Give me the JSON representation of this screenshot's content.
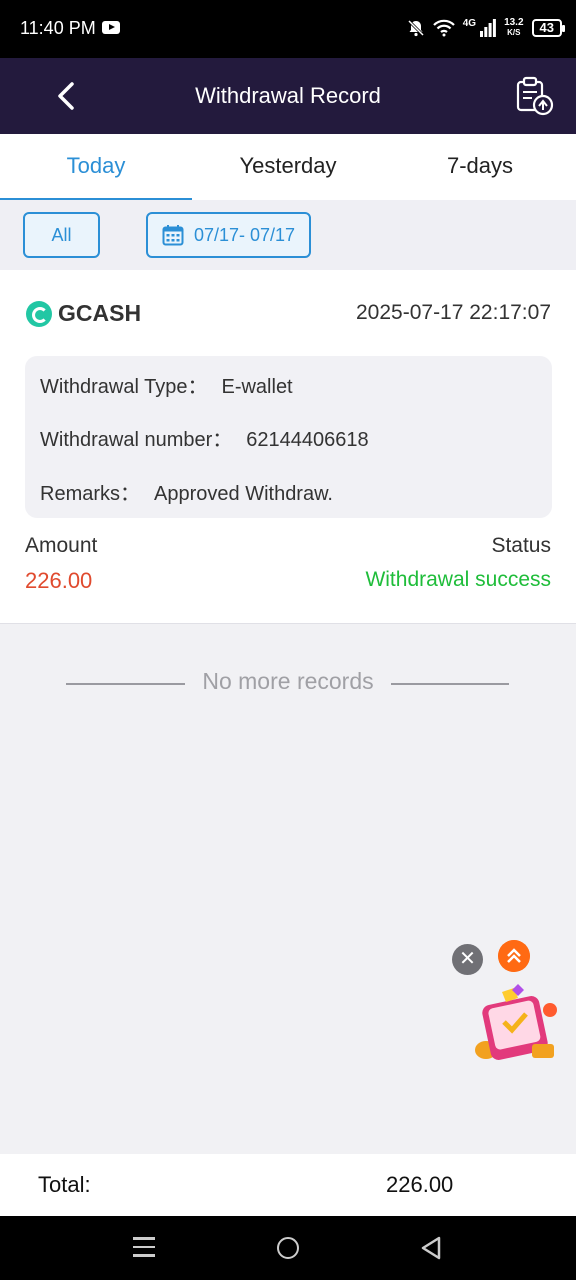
{
  "status_bar": {
    "time": "11:40 PM",
    "network_type": "4G",
    "speed_value": "13.2",
    "speed_unit": "K/S",
    "battery": "43"
  },
  "header": {
    "title": "Withdrawal Record"
  },
  "tabs": [
    {
      "label": "Today",
      "active": true
    },
    {
      "label": "Yesterday",
      "active": false
    },
    {
      "label": "7-days",
      "active": false
    }
  ],
  "filters": {
    "all_label": "All",
    "date_range": "07/17- 07/17"
  },
  "record": {
    "channel": "GCASH",
    "datetime": "2025-07-17 22:17:07",
    "type_label": "Withdrawal Type：",
    "type_value": "E-wallet",
    "number_label": "Withdrawal number：",
    "number_value": "62144406618",
    "remarks_label": "Remarks：",
    "remarks_value": "Approved Withdraw.",
    "amount_label": "Amount",
    "amount_value": "226.00",
    "status_label": "Status",
    "status_value": "Withdrawal success"
  },
  "list_footer": "No more records",
  "total": {
    "label": "Total:",
    "value": "226.00"
  },
  "colors": {
    "accent": "#2b8fd6",
    "header_bg": "#231a3d",
    "amount": "#e04a2e",
    "success": "#1fbd3a"
  }
}
